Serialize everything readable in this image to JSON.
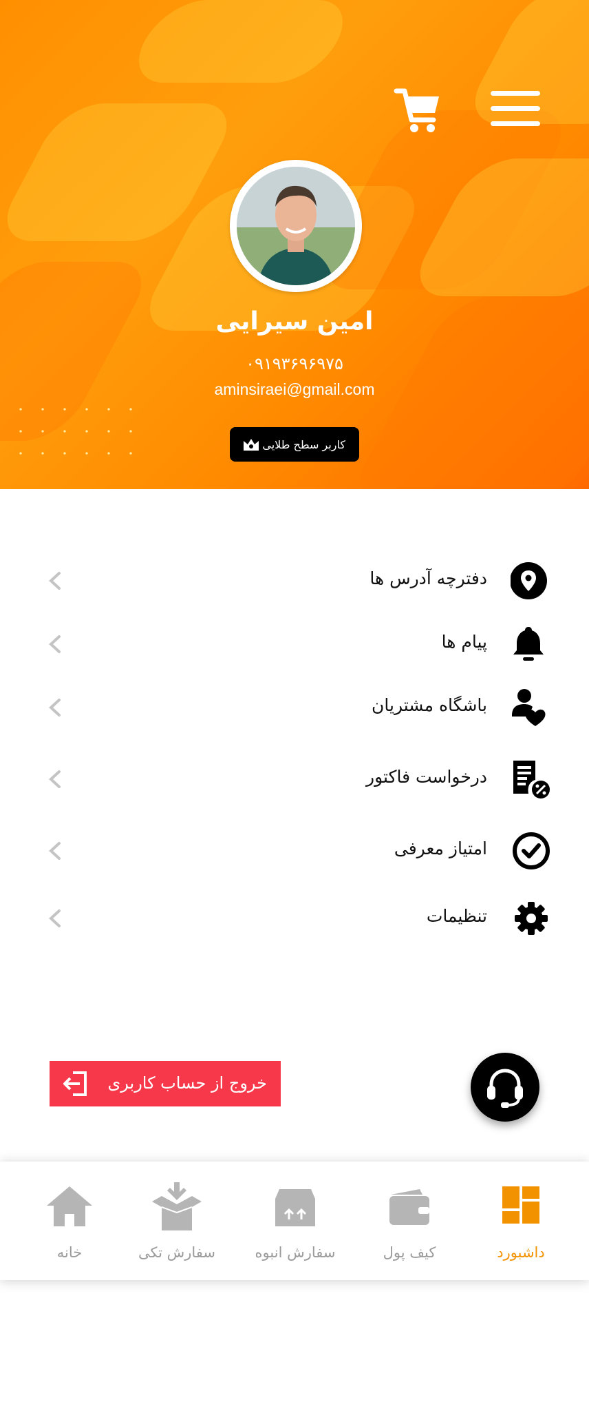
{
  "colors": {
    "accent": "#ff8f00",
    "logout": "#f7384a",
    "active_nav": "#f39200",
    "inactive_nav": "#b5b5b5",
    "badge_bg": "#000000"
  },
  "header": {
    "menu_icon": "hamburger-icon",
    "cart_icon": "cart-icon"
  },
  "profile": {
    "name": "امین سیرایی",
    "phone": "۰۹۱۹۳۶۹۶۹۷۵",
    "email": "aminsiraei@gmail.com",
    "badge_label": "کاربر سطح طلایی",
    "badge_icon": "crown-icon"
  },
  "menu": {
    "items": [
      {
        "label": "دفترچه آدرس ها",
        "icon": "location-pin-icon"
      },
      {
        "label": "پیام ها",
        "icon": "bell-icon"
      },
      {
        "label": "باشگاه مشتریان",
        "icon": "customer-club-icon"
      },
      {
        "label": "درخواست فاکتور",
        "icon": "invoice-icon"
      },
      {
        "label": "امتیاز معرفی",
        "icon": "check-circle-icon"
      },
      {
        "label": "تنظیمات",
        "icon": "gear-icon"
      }
    ]
  },
  "logout": {
    "label": "خروج از حساب کاربری",
    "icon": "logout-icon"
  },
  "support": {
    "icon": "headset-icon"
  },
  "bottom_nav": {
    "active": "dashboard",
    "items": [
      {
        "label": "خانه",
        "icon": "home-icon"
      },
      {
        "label": "سفارش تکی",
        "icon": "box-icon"
      },
      {
        "label": "سفارش انبوه",
        "icon": "bulk-box-icon"
      },
      {
        "label": "کیف پول",
        "icon": "wallet-icon"
      },
      {
        "label": "داشبورد",
        "icon": "dashboard-icon"
      }
    ]
  }
}
